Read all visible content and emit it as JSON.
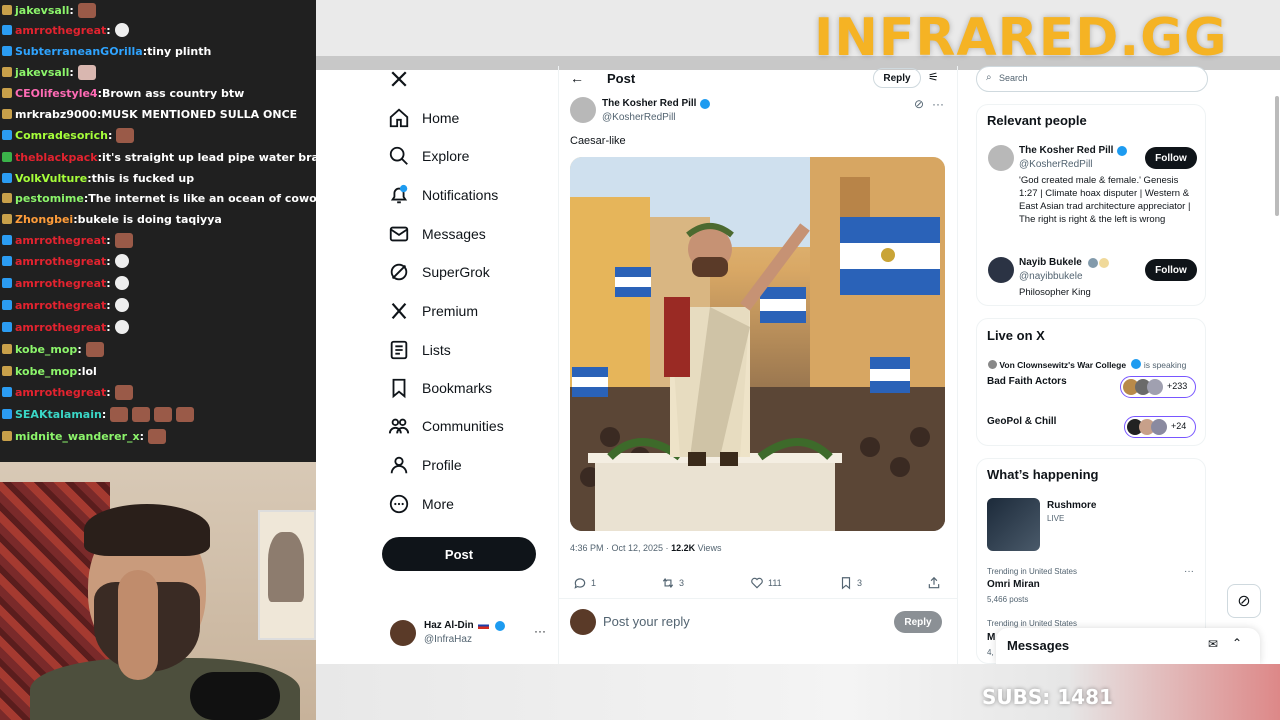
{
  "chat": {
    "messages": [
      {
        "user": "jakevsall",
        "color": "#8cf56b",
        "text": "",
        "emote": "face",
        "badge": "b-sub"
      },
      {
        "user": "amrrothegreat",
        "color": "#e3232f",
        "text": "",
        "emote": "skull",
        "badge": "b-prime"
      },
      {
        "user": "SubterraneanGOrilla",
        "color": "#2fa4ff",
        "text": "tiny plinth",
        "emote": "",
        "badge": "b-prime"
      },
      {
        "user": "jakevsall",
        "color": "#8cf56b",
        "text": "",
        "emote": "cat",
        "badge": "b-sub"
      },
      {
        "user": "CEOlifestyle4",
        "color": "#ff6bb5",
        "text": "Brown ass country btw",
        "emote": "",
        "badge": "b-sub"
      },
      {
        "user": "mrkrabz9000",
        "color": "#ffffff",
        "text": "MUSK MENTIONED SULLA ONCE",
        "emote": "",
        "badge": "b-sub"
      },
      {
        "user": "Comradesorich",
        "color": "#a6ff3a",
        "text": "",
        "emote": "face",
        "badge": "b-prime"
      },
      {
        "user": "theblackpack",
        "color": "#e3232f",
        "text": "it's straight up lead pipe water brain",
        "emote": "",
        "badge": "b-grn"
      },
      {
        "user": "VolkVulture",
        "color": "#a6ff3a",
        "text": "this is fucked up",
        "emote": "",
        "badge": "b-prime"
      },
      {
        "user": "pestomime",
        "color": "#8cf56b",
        "text": "The internet is like an ocean of coworkers",
        "emote": "",
        "badge": "b-sub"
      },
      {
        "user": "Zhongbei",
        "color": "#ff9d3a",
        "text": "bukele is doing taqiyya",
        "emote": "",
        "badge": "b-sub"
      },
      {
        "user": "amrrothegreat",
        "color": "#e3232f",
        "text": "",
        "emote": "face",
        "badge": "b-prime"
      },
      {
        "user": "amrrothegreat",
        "color": "#e3232f",
        "text": "",
        "emote": "skull",
        "badge": "b-prime"
      },
      {
        "user": "amrrothegreat",
        "color": "#e3232f",
        "text": "",
        "emote": "skull",
        "badge": "b-prime"
      },
      {
        "user": "amrrothegreat",
        "color": "#e3232f",
        "text": "",
        "emote": "skull",
        "badge": "b-prime"
      },
      {
        "user": "amrrothegreat",
        "color": "#e3232f",
        "text": "",
        "emote": "skull",
        "badge": "b-prime"
      },
      {
        "user": "kobe_mop",
        "color": "#8cf56b",
        "text": "",
        "emote": "face",
        "badge": "b-sub"
      },
      {
        "user": "kobe_mop",
        "color": "#8cf56b",
        "text": "lol",
        "emote": "",
        "badge": "b-sub"
      },
      {
        "user": "amrrothegreat",
        "color": "#e3232f",
        "text": "",
        "emote": "face",
        "badge": "b-prime"
      },
      {
        "user": "SEAKtalamain",
        "color": "#3ad6c6",
        "text": "",
        "emote": "face4",
        "badge": "b-prime"
      },
      {
        "user": "midnite_wanderer_x",
        "color": "#8cf56b",
        "text": "",
        "emote": "face",
        "badge": "b-sub"
      }
    ]
  },
  "brand": "INFRARED.GG",
  "subs": "SUBS: 1481",
  "nav": {
    "items": [
      {
        "label": "Home",
        "icon": "home-icon"
      },
      {
        "label": "Explore",
        "icon": "search-icon"
      },
      {
        "label": "Notifications",
        "icon": "bell-icon"
      },
      {
        "label": "Messages",
        "icon": "mail-icon"
      },
      {
        "label": "SuperGrok",
        "icon": "grok-icon"
      },
      {
        "label": "Premium",
        "icon": "x-icon"
      },
      {
        "label": "Lists",
        "icon": "list-icon"
      },
      {
        "label": "Bookmarks",
        "icon": "bookmark-icon"
      },
      {
        "label": "Communities",
        "icon": "people-icon"
      },
      {
        "label": "Profile",
        "icon": "person-icon"
      },
      {
        "label": "More",
        "icon": "more-icon"
      }
    ],
    "post_label": "Post",
    "me": {
      "name": "Haz Al-Din",
      "handle": "@InfraHaz"
    }
  },
  "post": {
    "header_title": "Post",
    "reply_label": "Reply",
    "author": "The Kosher Red Pill",
    "handle": "@KosherRedPill",
    "text": "Caesar-like",
    "time": "4:36 PM · Oct 12, 2025 · ",
    "views": "12.2K",
    "views_label": " Views",
    "replies": "1",
    "reposts": "3",
    "likes": "111",
    "bookmarks": "3",
    "reply_placeholder": "Post your reply",
    "reply_button": "Reply"
  },
  "sidebar": {
    "search_placeholder": "Search",
    "relevant_title": "Relevant people",
    "people": [
      {
        "name": "The Kosher Red Pill",
        "handle": "@KosherRedPill",
        "bio": "'God created male & female.' Genesis 1:27 | Climate hoax disputer | Western & East Asian trad architecture appreciator | The right is right & the left is wrong",
        "follow": "Follow"
      },
      {
        "name": "Nayib Bukele",
        "handle": "@nayibbukele",
        "bio": "Philosopher King",
        "follow": "Follow"
      }
    ],
    "live_title": "Live on X",
    "live_host": "Von Clownsewitz's War College",
    "live_status": "is speaking",
    "spaces": [
      {
        "title": "Bad Faith Actors",
        "count": "+233"
      },
      {
        "title": "GeoPol & Chill",
        "count": "+24"
      }
    ],
    "happening_title": "What’s happening",
    "happening_item": {
      "title": "Rushmore",
      "status": "LIVE"
    },
    "trends": [
      {
        "context": "Trending in United States",
        "title": "Omri Miran",
        "count": "5,466 posts"
      },
      {
        "context": "Trending in United States",
        "title": "M",
        "count": "4,"
      }
    ],
    "messages_label": "Messages"
  }
}
